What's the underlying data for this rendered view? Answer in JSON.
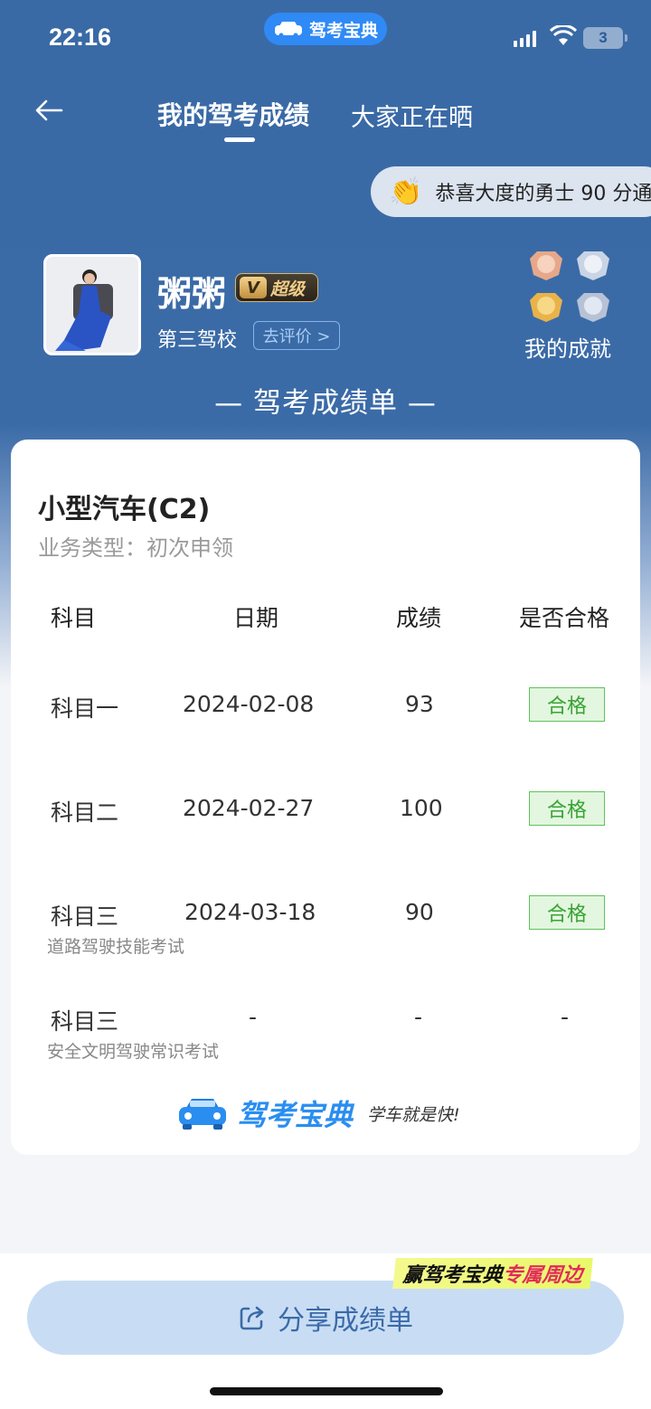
{
  "status_bar": {
    "time": "22:16",
    "battery": "3",
    "app_badge": "驾考宝典"
  },
  "nav": {
    "tab_active": "我的驾考成绩",
    "tab_other": "大家正在晒"
  },
  "congrats_banner": {
    "icon": "clap-icon",
    "text": "恭喜大度的勇士 90 分通"
  },
  "profile": {
    "username": "粥粥",
    "vip_v": "V",
    "vip_label": "超级",
    "school": "第三驾校",
    "review_button": "去评价 >",
    "achievements_label": "我的成就"
  },
  "sheet_title": "— 驾考成绩单 —",
  "card": {
    "vehicle": "小型汽车(C2)",
    "business_type": "业务类型：初次申领",
    "headers": [
      "科目",
      "日期",
      "成绩",
      "是否合格"
    ],
    "rows": [
      {
        "subject": "科目一",
        "note": "",
        "date": "2024-02-08",
        "score": "93",
        "result": "合格"
      },
      {
        "subject": "科目二",
        "note": "",
        "date": "2024-02-27",
        "score": "100",
        "result": "合格"
      },
      {
        "subject": "科目三",
        "note": "道路驾驶技能考试",
        "date": "2024-03-18",
        "score": "90",
        "result": "合格"
      },
      {
        "subject": "科目三",
        "note": "安全文明驾驶常识考试",
        "date": "-",
        "score": "-",
        "result": "-"
      }
    ],
    "brand_name": "驾考宝典",
    "brand_slogan": "学车就是快!"
  },
  "promo": {
    "prefix": "赢驾考宝典",
    "highlight": "专属周边"
  },
  "share_button": "分享成绩单",
  "colors": {
    "header_blue": "#3a6aa6",
    "pass_green": "#38a336",
    "brand_blue": "#2a8ef0",
    "button_bg": "#c8ddf4"
  }
}
